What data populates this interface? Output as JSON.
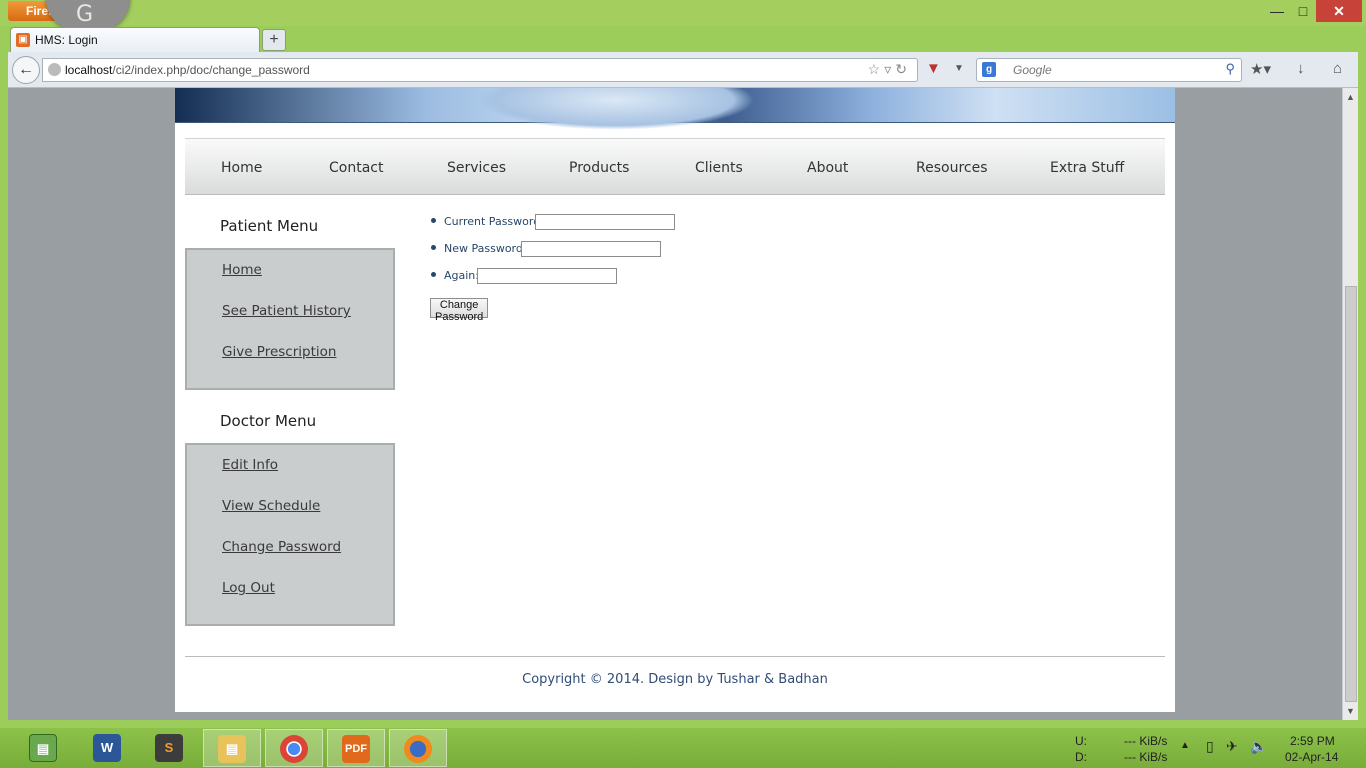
{
  "browser": {
    "menu_button": "Firefox",
    "overlay_letter": "G",
    "tab_title": "HMS: Login",
    "url_host": "localhost",
    "url_path": "/ci2/index.php/doc/change_password",
    "search_placeholder": "Google"
  },
  "site": {
    "nav": [
      "Home",
      "Contact",
      "Services",
      "Products",
      "Clients",
      "About",
      "Resources",
      "Extra Stuff"
    ],
    "patient_menu": {
      "title": "Patient Menu",
      "items": [
        "Home",
        "See Patient History",
        "Give Prescription"
      ]
    },
    "doctor_menu": {
      "title": "Doctor Menu",
      "items": [
        "Edit Info",
        "View Schedule",
        "Change Password",
        "Log Out"
      ]
    },
    "form": {
      "current_label": "Current Password:",
      "new_label": "New Password:",
      "again_label": "Again:",
      "submit_label": "Change Password"
    },
    "footer": "Copyright © 2014. Design by Tushar & Badhan"
  },
  "taskbar": {
    "apps": [
      "presentation-app",
      "Word",
      "Sublime",
      "File Explorer",
      "Chrome",
      "PDF",
      "Firefox"
    ],
    "active_app": "Firefox",
    "net_up_label": "U:",
    "net_down_label": "D:",
    "net_up_value": "--- KiB/s",
    "net_down_value": "--- KiB/s",
    "time": "2:59 PM",
    "date": "02-Apr-14"
  }
}
